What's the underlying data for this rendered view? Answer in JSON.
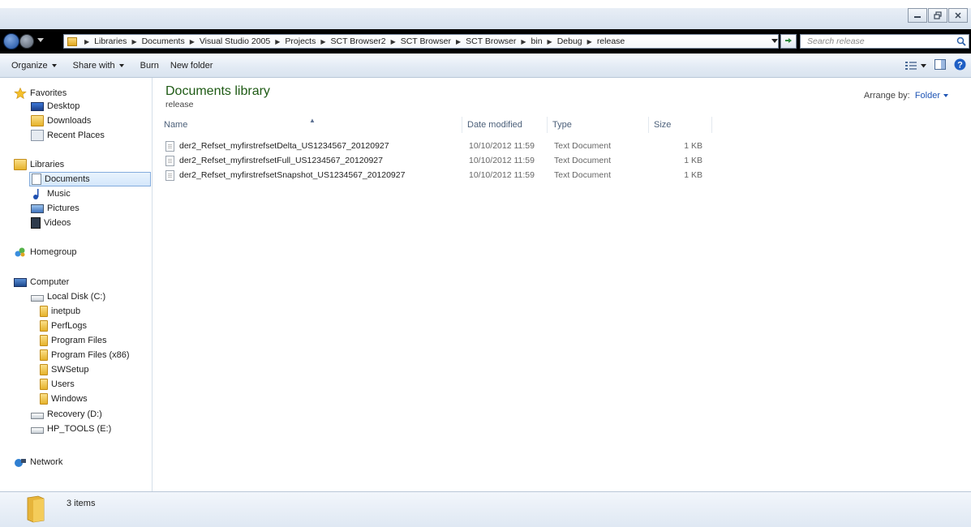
{
  "window": {
    "caption_buttons": [
      "minimize-icon",
      "restore-icon",
      "close-icon"
    ]
  },
  "address_bar": {
    "crumbs": [
      "Libraries",
      "Documents",
      "Visual Studio 2005",
      "Projects",
      "SCT Browser2",
      "SCT Browser",
      "SCT Browser",
      "bin",
      "Debug",
      "release"
    ],
    "search_placeholder": "Search release"
  },
  "toolbar": {
    "organize": "Organize",
    "share_with": "Share with",
    "burn": "Burn",
    "new_folder": "New folder"
  },
  "nav": {
    "favorites": "Favorites",
    "desktop": "Desktop",
    "downloads": "Downloads",
    "recent_places": "Recent Places",
    "libraries": "Libraries",
    "documents": "Documents",
    "music": "Music",
    "pictures": "Pictures",
    "videos": "Videos",
    "homegroup": "Homegroup",
    "computer": "Computer",
    "local_disk": "Local Disk (C:)",
    "inetpub": "inetpub",
    "perflogs": "PerfLogs",
    "program_files": "Program Files",
    "program_files_x86": "Program Files (x86)",
    "swsetup": "SWSetup",
    "users": "Users",
    "windows": "Windows",
    "recovery": "Recovery (D:)",
    "hp_tools": "HP_TOOLS (E:)",
    "network": "Network"
  },
  "main": {
    "library_title": "Documents library",
    "library_subtitle": "release",
    "arrange_label": "Arrange by:",
    "arrange_value": "Folder",
    "columns": {
      "name": "Name",
      "date": "Date modified",
      "type": "Type",
      "size": "Size"
    },
    "files": [
      {
        "name": "der2_Refset_myfirstrefsetDelta_US1234567_20120927",
        "date": "10/10/2012 11:59",
        "type": "Text Document",
        "size": "1 KB"
      },
      {
        "name": "der2_Refset_myfirstrefsetFull_US1234567_20120927",
        "date": "10/10/2012 11:59",
        "type": "Text Document",
        "size": "1 KB"
      },
      {
        "name": "der2_Refset_myfirstrefsetSnapshot_US1234567_20120927",
        "date": "10/10/2012 11:59",
        "type": "Text Document",
        "size": "1 KB"
      }
    ]
  },
  "details": {
    "item_count": "3 items"
  }
}
